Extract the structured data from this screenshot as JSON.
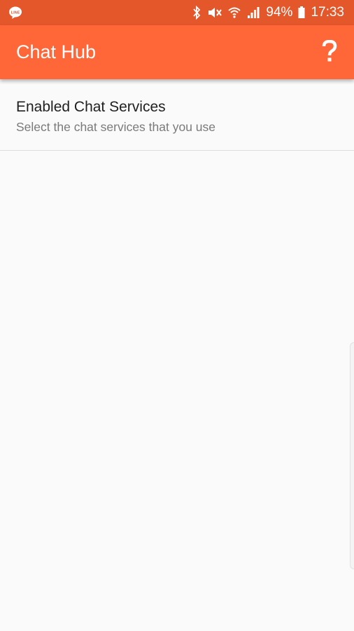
{
  "status_bar": {
    "battery": "94%",
    "time": "17:33",
    "notification_icon": "line-app-icon",
    "icons": [
      "bluetooth-icon",
      "mute-icon",
      "wifi-icon",
      "signal-icon",
      "battery-icon"
    ],
    "background": "#e4572a"
  },
  "app_bar": {
    "title": "Chat Hub",
    "help_icon": "question-mark-icon",
    "background": "#ff6739"
  },
  "preference": {
    "title": "Enabled Chat Services",
    "summary": "Select the chat services that you use"
  }
}
